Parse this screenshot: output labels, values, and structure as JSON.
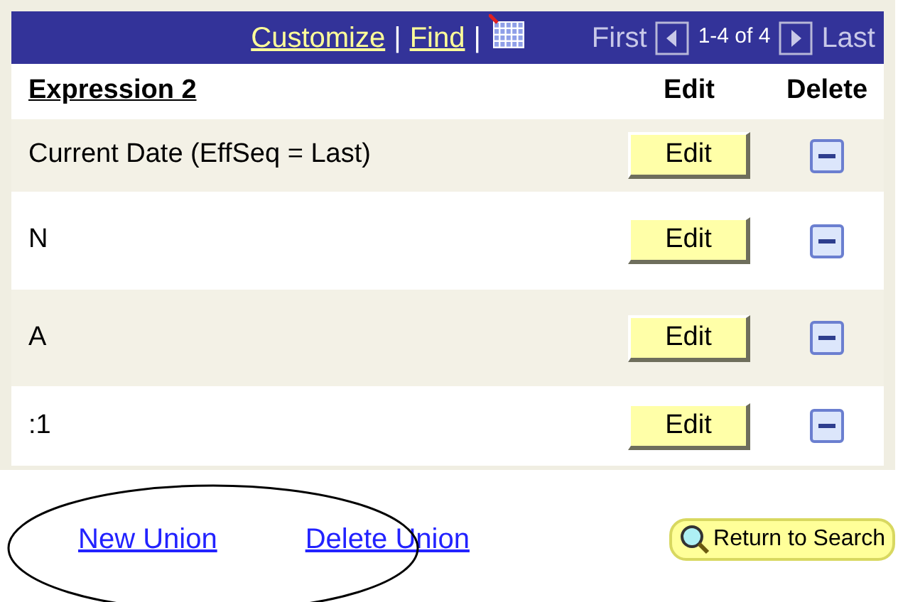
{
  "navigation_bar": {
    "customize_link": "Customize",
    "separator_1": "|",
    "find_link": "Find",
    "separator_2": "|",
    "first": "First",
    "range": "1-4 of 4",
    "last": "Last"
  },
  "table": {
    "columns": [
      {
        "label": "Expression 2",
        "kind": "link"
      },
      {
        "label": "Edit",
        "kind": "plain"
      },
      {
        "label": "Delete",
        "kind": "plain"
      }
    ],
    "rows": [
      {
        "expression": "Current Date (EffSeq = Last)",
        "edit_button": "Edit"
      },
      {
        "expression": "N",
        "edit_button": "Edit"
      },
      {
        "expression": "A",
        "edit_button": "Edit"
      },
      {
        "expression": ":1",
        "edit_button": "Edit"
      }
    ]
  },
  "links": [
    "New Union",
    "Delete Union"
  ],
  "return_button": "Return to Search"
}
